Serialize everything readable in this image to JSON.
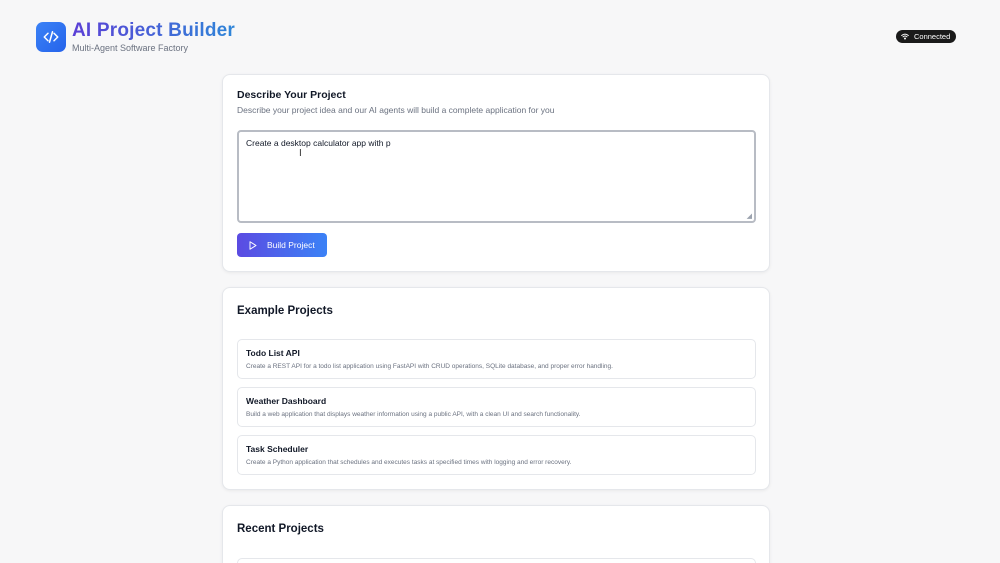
{
  "header": {
    "title": "AI Project Builder",
    "subtitle": "Multi-Agent Software Factory",
    "status": "Connected",
    "logo_icon": "code-icon",
    "status_icon": "wifi-icon"
  },
  "describe": {
    "title": "Describe Your Project",
    "subtitle": "Describe your project idea and our AI agents will build a complete application for you",
    "input_value": "Create a desktop calculator app with p",
    "build_label": "Build Project",
    "build_icon": "play-icon"
  },
  "examples": {
    "title": "Example Projects",
    "items": [
      {
        "title": "Todo List API",
        "description": "Create a REST API for a todo list application using FastAPI with CRUD operations, SQLite database, and proper error handling."
      },
      {
        "title": "Weather Dashboard",
        "description": "Build a web application that displays weather information using a public API, with a clean UI and search functionality."
      },
      {
        "title": "Task Scheduler",
        "description": "Create a Python application that schedules and executes tasks at specified times with logging and error recovery."
      }
    ]
  },
  "recent": {
    "title": "Recent Projects"
  },
  "colors": {
    "accent_start": "#5b4be2",
    "accent_end": "#3b82f6",
    "status_bg": "#1a1a1a"
  }
}
